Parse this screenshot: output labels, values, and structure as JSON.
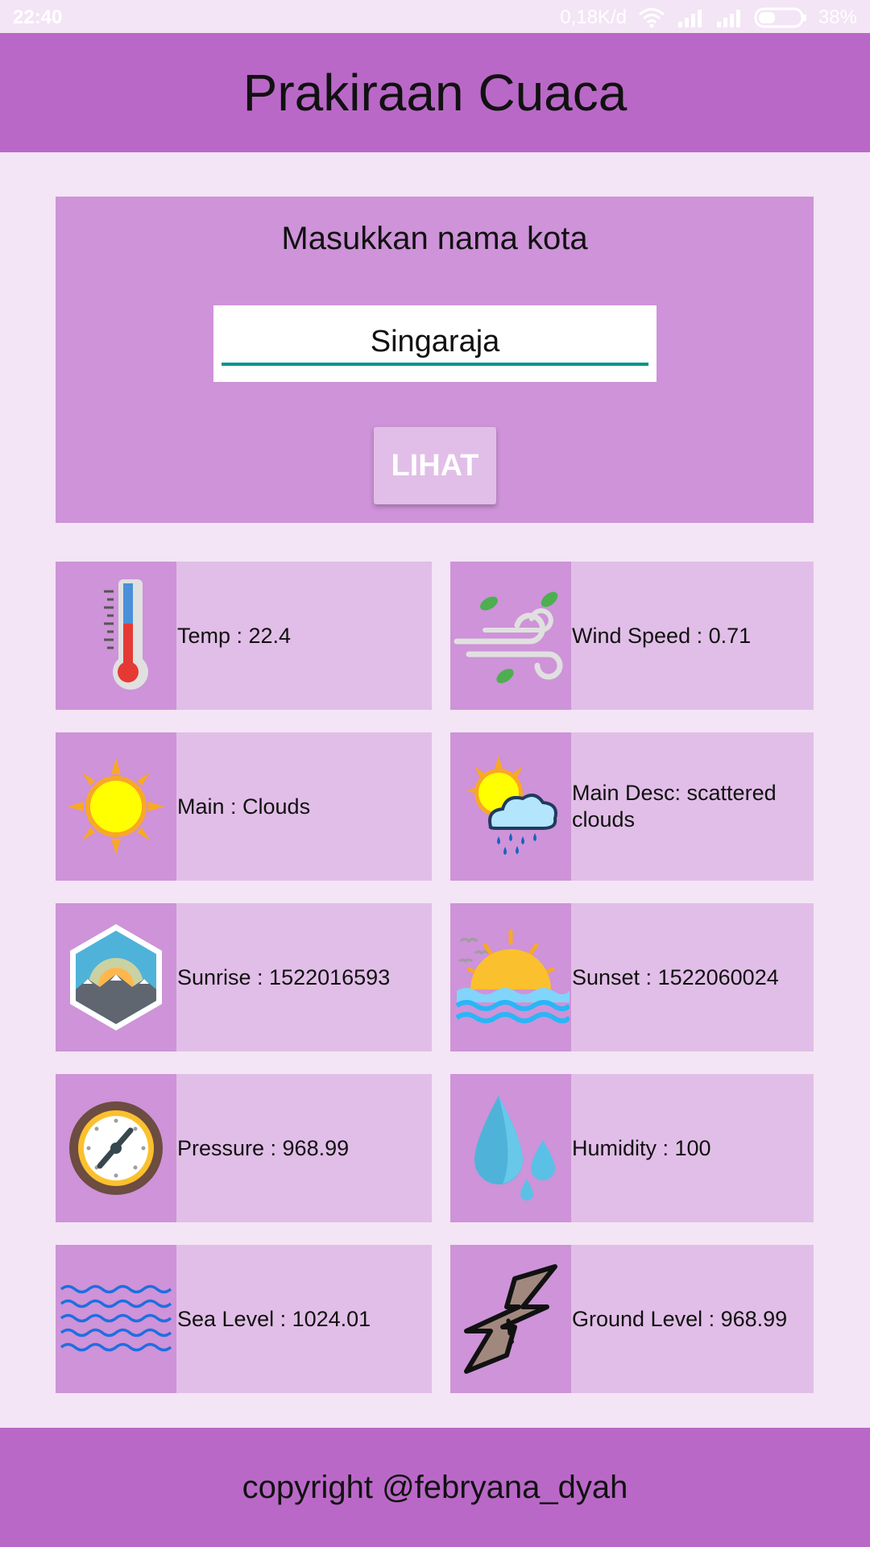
{
  "status_bar": {
    "time": "22:40",
    "network_speed": "0,18K/d",
    "battery": "38%"
  },
  "app_bar": {
    "title": "Prakiraan Cuaca"
  },
  "search": {
    "prompt": "Masukkan nama kota",
    "city_value": "Singaraja",
    "button_label": "LIHAT"
  },
  "weather": {
    "temp": "Temp : 22.4",
    "wind_speed": "Wind Speed :  0.71",
    "main": "Main : Clouds",
    "main_desc": "Main Desc:  scattered clouds",
    "sunrise": "Sunrise :  1522016593",
    "sunset": "Sunset :  1522060024",
    "pressure": "Pressure :  968.99",
    "humidity": "Humidity :  100",
    "sea_level": "Sea Level :  1024.01",
    "ground_level": "Ground Level :  968.99"
  },
  "footer": {
    "copyright": "copyright @febryana_dyah"
  },
  "colors": {
    "app_bar": "#ba68c8",
    "card": "#ce93d8",
    "tile": "#e1bee7",
    "background": "#f3e5f5",
    "underline": "#009688"
  }
}
